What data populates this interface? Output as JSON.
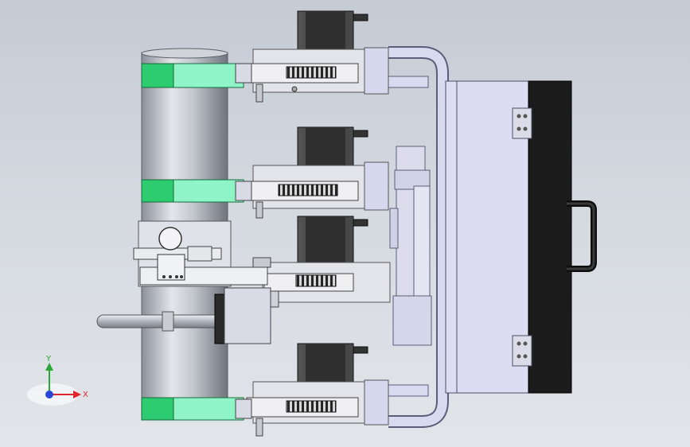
{
  "viewport": {
    "background_top": "#c5cbd5",
    "background_bottom": "#e2e5ea"
  },
  "model": {
    "colors": {
      "steel": "#c9cdd6",
      "steel_dark": "#7c8290",
      "frame": "#d6d8ee",
      "frame_edge": "#5a5e78",
      "motor": "#3d3d3d",
      "motor_light": "#6a6a6a",
      "clamp_green": "#2ecc71",
      "clamp_mint": "#8ff5c6",
      "case_black": "#1a1a1a",
      "gear": "#222222"
    },
    "parts": [
      "pipe",
      "mounting-frame",
      "carrying-case",
      "case-handle",
      "stepper-motor",
      "gear-rack",
      "pipe-clamp",
      "welding-torch",
      "slide-rail"
    ]
  },
  "triad": {
    "x_label": "X",
    "y_label": "Y",
    "x_color": "#e0242c",
    "y_color": "#2aa836",
    "z_color": "#2a48d8"
  }
}
